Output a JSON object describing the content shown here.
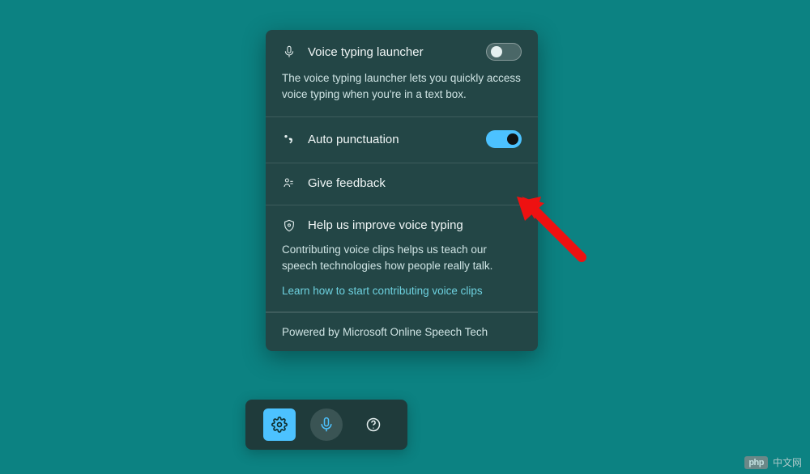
{
  "panel": {
    "launcher": {
      "title": "Voice typing launcher",
      "desc": "The voice typing launcher lets you quickly access voice typing when you're in a text box.",
      "enabled": false
    },
    "auto_punctuation": {
      "title": "Auto punctuation",
      "enabled": true
    },
    "feedback": {
      "title": "Give feedback"
    },
    "improve": {
      "title": "Help us improve voice typing",
      "desc": "Contributing voice clips helps us teach our speech technologies how people really talk.",
      "link": "Learn how to start contributing voice clips"
    },
    "footer": "Powered by Microsoft Online Speech Tech"
  },
  "watermark": {
    "badge": "php",
    "text": "中文网"
  }
}
